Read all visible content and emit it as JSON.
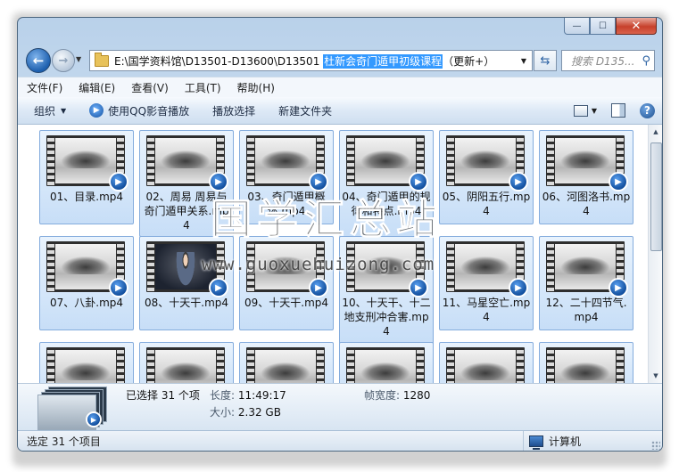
{
  "window": {
    "buttons": {
      "minimize": "—",
      "maximize": "☐",
      "close": "✕"
    }
  },
  "nav": {
    "back_glyph": "←",
    "forward_glyph": "→",
    "address_prefix": "E:\\国学资料馆\\D13501-D13600\\D13501 ",
    "address_selected": "杜新会奇门遁甲初级课程",
    "address_suffix": "（更新+）",
    "search_placeholder": "搜索 D135..."
  },
  "menu": [
    "文件(F)",
    "编辑(E)",
    "查看(V)",
    "工具(T)",
    "帮助(H)"
  ],
  "toolbar": {
    "organize": "组织",
    "play_qq": "使用QQ影音播放",
    "play_selection": "播放选择",
    "new_folder": "新建文件夹",
    "help_glyph": "?"
  },
  "files": [
    {
      "name": "01、目录.mp4",
      "thumb": "mountain"
    },
    {
      "name": "02、周易 周易与奇门遁甲关系.mp4",
      "thumb": "mountain"
    },
    {
      "name": "03、奇门遁甲概述.mp4",
      "thumb": "mountain"
    },
    {
      "name": "04、奇门遁甲的规律和特点.mp4",
      "thumb": "mountain"
    },
    {
      "name": "05、阴阳五行.mp4",
      "thumb": "mountain"
    },
    {
      "name": "06、河图洛书.mp4",
      "thumb": "mountain"
    },
    {
      "name": "07、八卦.mp4",
      "thumb": "mountain"
    },
    {
      "name": "08、十天干.mp4",
      "thumb": "person"
    },
    {
      "name": "09、十天干.mp4",
      "thumb": "mountain"
    },
    {
      "name": "10、十天干、十二地支刑冲合害.mp4",
      "thumb": "mountain"
    },
    {
      "name": "11、马星空亡.mp4",
      "thumb": "mountain"
    },
    {
      "name": "12、二十四节气.mp4",
      "thumb": "mountain"
    },
    {
      "name": "",
      "thumb": "mountain"
    },
    {
      "name": "",
      "thumb": "mountain"
    },
    {
      "name": "",
      "thumb": "mountain"
    },
    {
      "name": "",
      "thumb": "mountain"
    },
    {
      "name": "",
      "thumb": "mountain"
    },
    {
      "name": "",
      "thumb": "mountain"
    }
  ],
  "details": {
    "selected": "已选择 31 个项",
    "length_label": "长度:",
    "length_value": "11:49:17",
    "width_label": "帧宽度:",
    "width_value": "1280",
    "size_label": "大小:",
    "size_value": "2.32 GB"
  },
  "status": {
    "left": "选定 31 个项目",
    "right": "计算机"
  },
  "watermark": {
    "text": "国学汇总站",
    "url": "www.guoxuehuizong.com"
  },
  "colors": {
    "selection": "#3399ff",
    "window_frame": "#b9d1ea",
    "tile_selected": "#c7def7"
  }
}
